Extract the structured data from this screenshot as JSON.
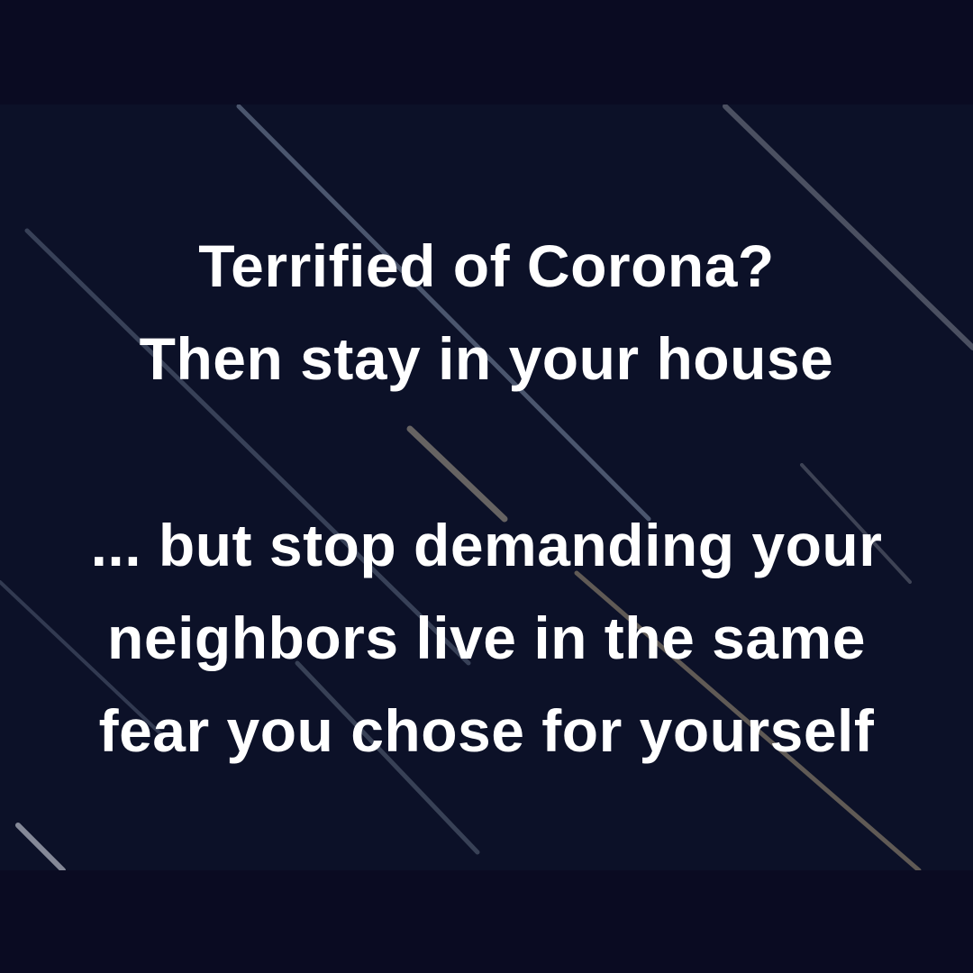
{
  "meme": {
    "lines": [
      "Terrified of Corona?",
      "Then stay in your house",
      "... but stop demanding your",
      "neighbors live in the same",
      "fear you chose for yourself"
    ]
  },
  "colors": {
    "background": "#0a0b22",
    "panel": "#0c1128",
    "text": "#ffffff"
  }
}
